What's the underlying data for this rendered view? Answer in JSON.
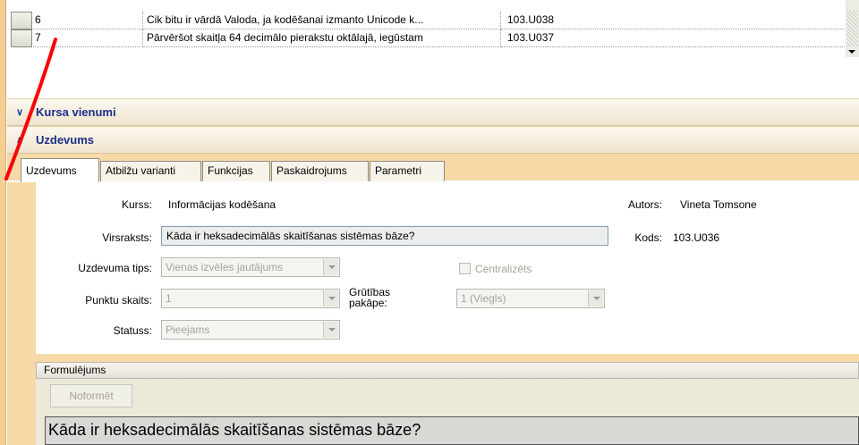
{
  "grid": {
    "rows": [
      {
        "num": "6",
        "text": "Cik bitu ir vārdā Valoda, ja kodēšanai izmanto Unicode k...",
        "code": "103.U038"
      },
      {
        "num": "7",
        "text": "Pārvēršot skaitļa 64 decimālo pierakstu oktālajā, iegūstam",
        "code": "103.U037"
      }
    ]
  },
  "sections": {
    "kursa_vienumi": "Kursa vienumi",
    "uzdevums": "Uzdevums"
  },
  "tabs": [
    {
      "label": "Uzdevums"
    },
    {
      "label": "Atbilžu varianti"
    },
    {
      "label": "Funkcijas"
    },
    {
      "label": "Paskaidrojums"
    },
    {
      "label": "Parametri"
    }
  ],
  "form": {
    "kurss_label": "Kurss:",
    "kurss_value": "Informācijas kodēšana",
    "autors_label": "Autors:",
    "autors_value": "Vineta Tomsone",
    "virsraksts_label": "Virsraksts:",
    "virsraksts_value": "Kāda ir heksadecimālās skaitīšanas sistēmas bāze?",
    "kods_label": "Kods:",
    "kods_value": "103.U036",
    "tips_label": "Uzdevuma tips:",
    "tips_value": "Vienas izvēles jautājums",
    "centralizets_label": "Centralizēts",
    "punktu_label": "Punktu skaits:",
    "punktu_value": "1",
    "grutibas_label": "Grūtības pakāpe:",
    "grutibas_value": "1 (Viegls)",
    "statuss_label": "Statuss:",
    "statuss_value": "Pieejams"
  },
  "formulejums": {
    "title": "Formulējums",
    "noformet_label": "Noformēt",
    "text": "Kāda ir heksadecimālās skaitīšanas sistēmas bāze?"
  },
  "colors": {
    "accent_orange": "#f6d9a6",
    "header_text": "#1c2f8a",
    "annotation_red": "#ff0000"
  }
}
